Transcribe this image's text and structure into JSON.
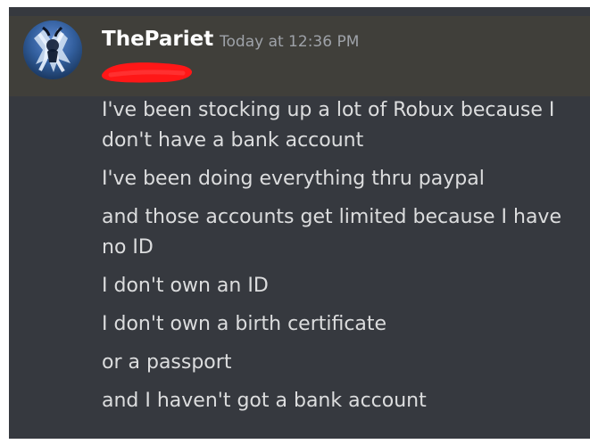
{
  "message": {
    "author": "ThePariet",
    "timestamp": "Today at 12:36 PM",
    "avatar_icon": "user-avatar",
    "redaction_color": "#ff1717",
    "lines": [
      "I've been stocking up a lot of Robux because I don't have a bank account",
      "I've been doing everything thru paypal",
      "and those accounts get limited because I have no ID",
      "I don't own an ID",
      "I don't own a birth certificate",
      "or a passport",
      "and I haven't got a bank account"
    ]
  },
  "theme": {
    "background": "#36393f",
    "header_band": "#403f3a",
    "username_color": "#ffffff",
    "timestamp_color": "#9ea2a8",
    "message_color": "#dcddde"
  }
}
